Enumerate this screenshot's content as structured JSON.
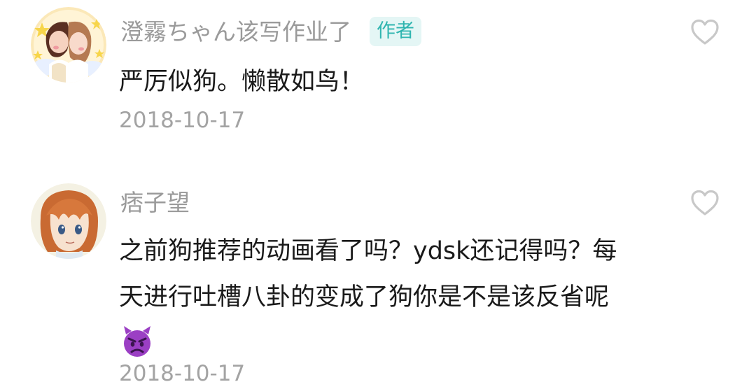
{
  "comments": [
    {
      "username": "澄霧ちゃん该写作业了",
      "badge": "作者",
      "content_lines": [
        "严厉似狗。懒散如鸟！"
      ],
      "timestamp": "2018-10-17",
      "avatar_icon": "anime-couple-avatar",
      "like_icon": "heart-outline-icon"
    },
    {
      "username": "痞子望",
      "content_lines": [
        "之前狗推荐的动画看了吗？ydsk还记得吗？每",
        "天进行吐槽八卦的变成了狗你是不是该反省呢"
      ],
      "emoji": "angry-devil-emoji",
      "timestamp": "2018-10-17",
      "avatar_icon": "anime-girl-avatar",
      "like_icon": "heart-outline-icon"
    }
  ],
  "colors": {
    "username": "#9a9a9a",
    "badge_bg": "#e4f6f5",
    "badge_text": "#2fb5b0",
    "content": "#1a1a1a",
    "timestamp": "#a3a3a3",
    "heart": "#c8c8c8",
    "emoji": "#9b3fc4"
  }
}
